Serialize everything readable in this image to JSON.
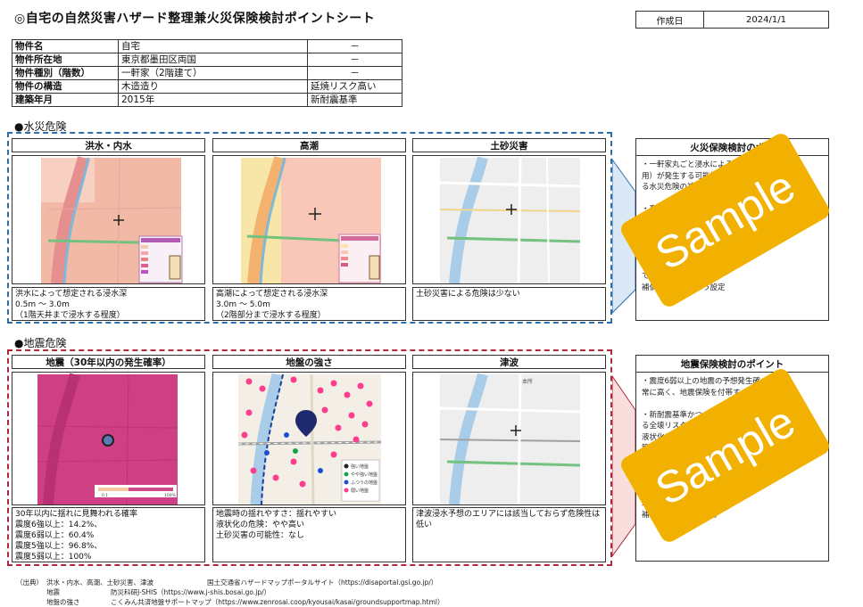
{
  "title": "◎自宅の自然災害ハザード整理兼火災保険検討ポイントシート",
  "date": {
    "label": "作成日",
    "value": "2024/1/1"
  },
  "property_table": [
    {
      "label": "物件名",
      "value": "自宅",
      "note": "－"
    },
    {
      "label": "物件所在地",
      "value": "東京都墨田区両国",
      "note": "－"
    },
    {
      "label": "物件種別（階数）",
      "value": "一軒家（2階建て）",
      "note": "－"
    },
    {
      "label": "物件の構造",
      "value": "木造造り",
      "note": "延焼リスク高い"
    },
    {
      "label": "建築年月",
      "value": "2015年",
      "note": "新耐震基準"
    }
  ],
  "water": {
    "heading": "●水災危険",
    "panels": [
      {
        "title": "洪水・内水",
        "desc": "洪水によって想定される浸水深\n0.5m ～ 3.0m\n（1階天井まで浸水する程度）"
      },
      {
        "title": "高潮",
        "desc": "高潮によって想定される浸水深\n3.0m ～ 5.0m\n（2階部分まで浸水する程度）"
      },
      {
        "title": "土砂災害",
        "desc": "土砂災害による危険は少ない"
      }
    ],
    "right_title": "火災保険検討のポイ",
    "right_body": "・一軒家丸ごと浸水による\n用）が発生する可能性\nる水災危険の補償\n\n・高額\n日\n\n\n\n・品や美術品や美術品等の\nであるため、「明記物\n補償可能になるよう設定"
  },
  "quake": {
    "heading": "●地震危険",
    "panels": [
      {
        "title": "地震（30年以内の発生確率）",
        "desc": "30年以内に揺れに見舞われる確率\n震度6強以上：14.2%、\n震度6弱以上：60.4%\n震度5強以上：96.8%、\n震度5弱以上：100%"
      },
      {
        "title": "地盤の強さ",
        "desc": "地震時の揺れやすさ：揺れやすい\n液状化の危険：やや高い\n土砂災害の可能性：なし"
      },
      {
        "title": "津波",
        "desc": "津波浸水予想のエリアには該当しておらず危険性は\n低い"
      }
    ],
    "right_title": "地震保険検討のポイント",
    "right_body": "・震度6弱以上の地震の予想発生確\n常に高く、地震保険を付帯す\n\n・新耐震基準かつ\nる全壊リスク\n液状化に\n築が\n\n\n\n\n場合には延焼リス\n補額特約を検討するこ"
  },
  "map_labels": {
    "station": "本所",
    "legend_strong": "強い地盤",
    "legend_some": "やや強い地盤",
    "legend_normal": "ふつうの地盤",
    "legend_weak": "弱い地盤",
    "scale_min": "0.1",
    "scale_max": "100%"
  },
  "sources": {
    "prefix": "（出典）",
    "rows": [
      {
        "item": "洪水・内水、高潮、土砂災害、津波",
        "source": "国土交通省ハザードマップポータルサイト（https://disaportal.gsi.go.jp/）"
      },
      {
        "item": "地震",
        "source": "防災科研J-SHIS（https://www.j-shis.bosai.go.jp/）"
      },
      {
        "item": "地盤の強さ",
        "source": "こくみん共済地盤サポートマップ（https://www.zenrosai.coop/kyousai/kasai/groundsupportmap.html）"
      }
    ]
  },
  "stamp_text": "Sample",
  "colors": {
    "water_border": "#2c6fad",
    "quake_border": "#b0283a",
    "stamp": "#f2b100"
  }
}
